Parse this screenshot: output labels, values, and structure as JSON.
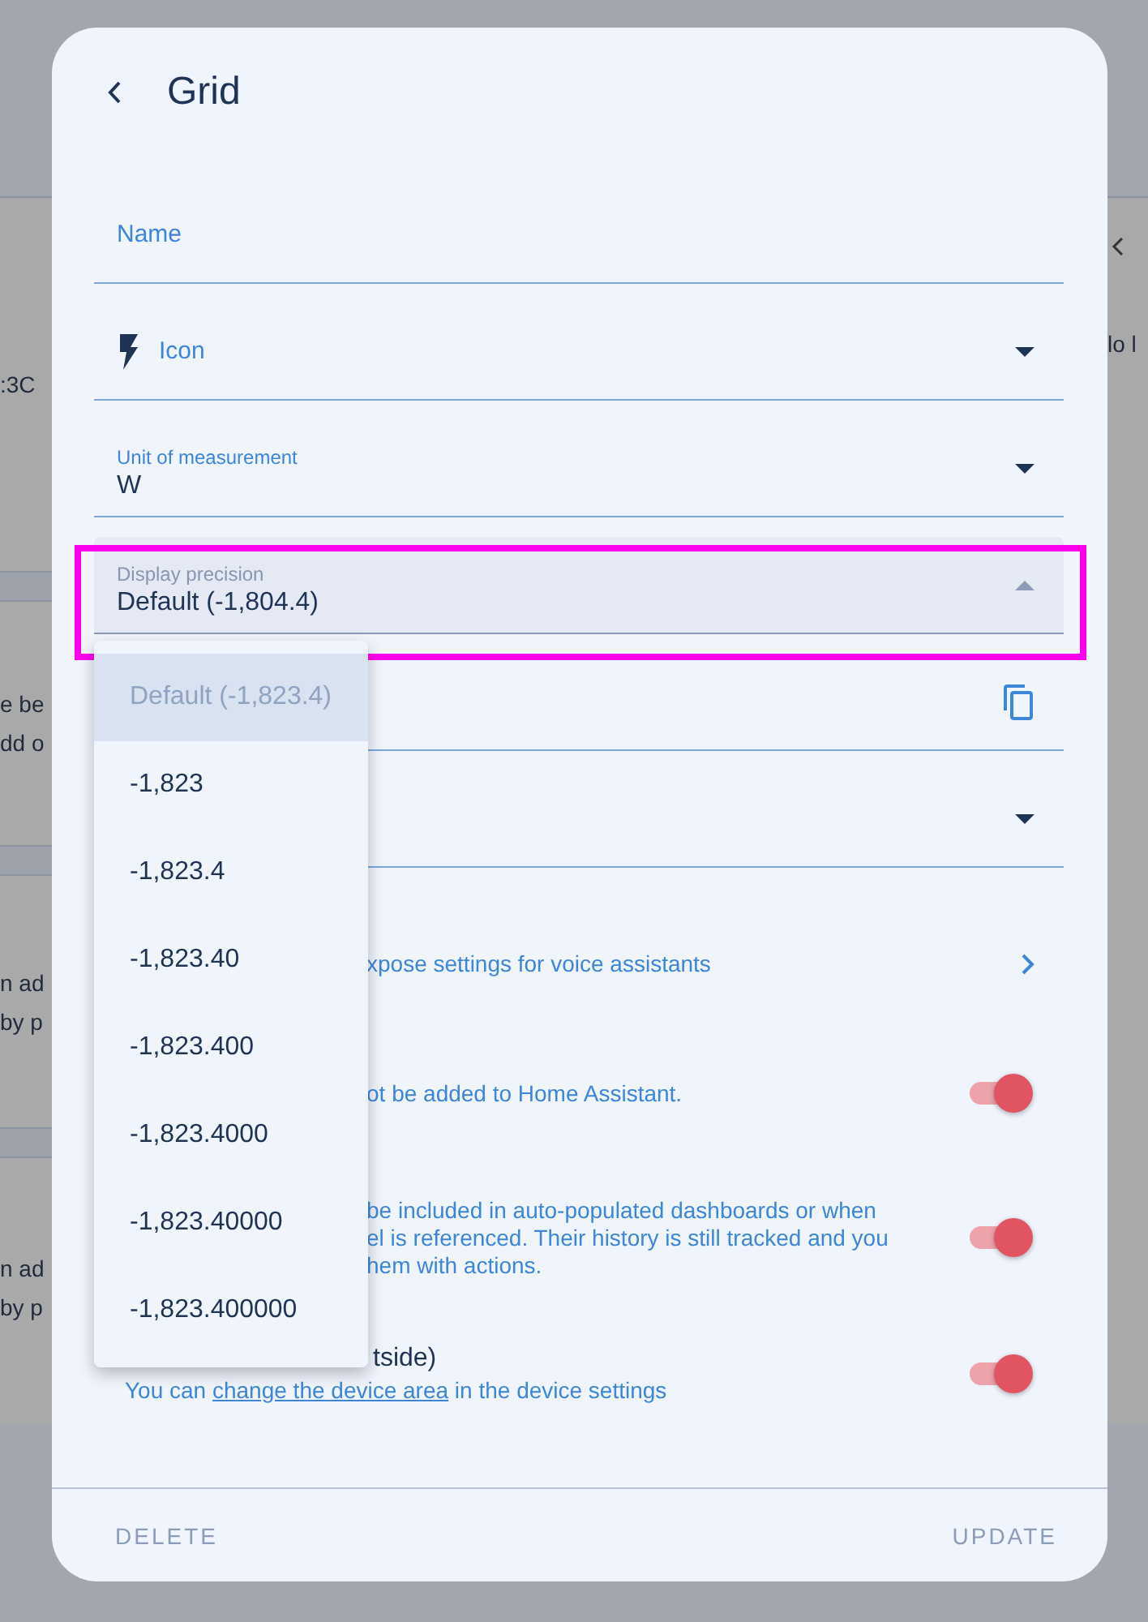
{
  "backdrop": {
    "left_blocks": [
      {
        "kind": "text",
        "lines": [
          ":3C"
        ]
      },
      {
        "kind": "band"
      },
      {
        "kind": "text",
        "lines": [
          "e be",
          "dd o"
        ]
      },
      {
        "kind": "band"
      },
      {
        "kind": "text",
        "lines": [
          "n ad",
          "by p"
        ]
      },
      {
        "kind": "band"
      },
      {
        "kind": "text",
        "lines": [
          "n ad",
          "by p"
        ]
      }
    ],
    "right_text": "lo l"
  },
  "dialog": {
    "title": "Grid",
    "fields": [
      {
        "kind": "plain",
        "label": "Name"
      },
      {
        "kind": "icon-select",
        "label": "Icon"
      },
      {
        "kind": "select",
        "label": "Unit of measurement",
        "value": "W"
      },
      {
        "kind": "select",
        "label": "Display precision",
        "value": "Default (-1,804.4)",
        "expanded": true
      },
      {
        "kind": "copy"
      },
      {
        "kind": "select"
      }
    ],
    "menu": [
      {
        "label": "Default (-1,823.4)",
        "selected": true
      },
      {
        "label": "-1,823",
        "selected": false
      },
      {
        "label": "-1,823.4",
        "selected": false
      },
      {
        "label": "-1,823.40",
        "selected": false
      },
      {
        "label": "-1,823.400",
        "selected": false
      },
      {
        "label": "-1,823.4000",
        "selected": false
      },
      {
        "label": "-1,823.40000",
        "selected": false
      },
      {
        "label": "-1,823.400000",
        "selected": false
      }
    ],
    "rows": [
      {
        "kind": "link",
        "fragment_lines": [
          "xpose settings for voice assistants"
        ]
      },
      {
        "kind": "toggle",
        "on": true,
        "fragment_lines": [
          "ot be added to Home Assistant."
        ]
      },
      {
        "kind": "toggle",
        "on": true,
        "fragment_lines": [
          "be included in auto-populated dashboards or when",
          "el is referenced. Their history is still tracked and you",
          "hem with actions."
        ]
      },
      {
        "kind": "toggle",
        "on": true,
        "title_fragment": "tside)",
        "description": {
          "before": "You can ",
          "link": "change the device area",
          "after": " in the device settings"
        }
      }
    ],
    "actions": [
      "DELETE",
      "UPDATE"
    ]
  }
}
